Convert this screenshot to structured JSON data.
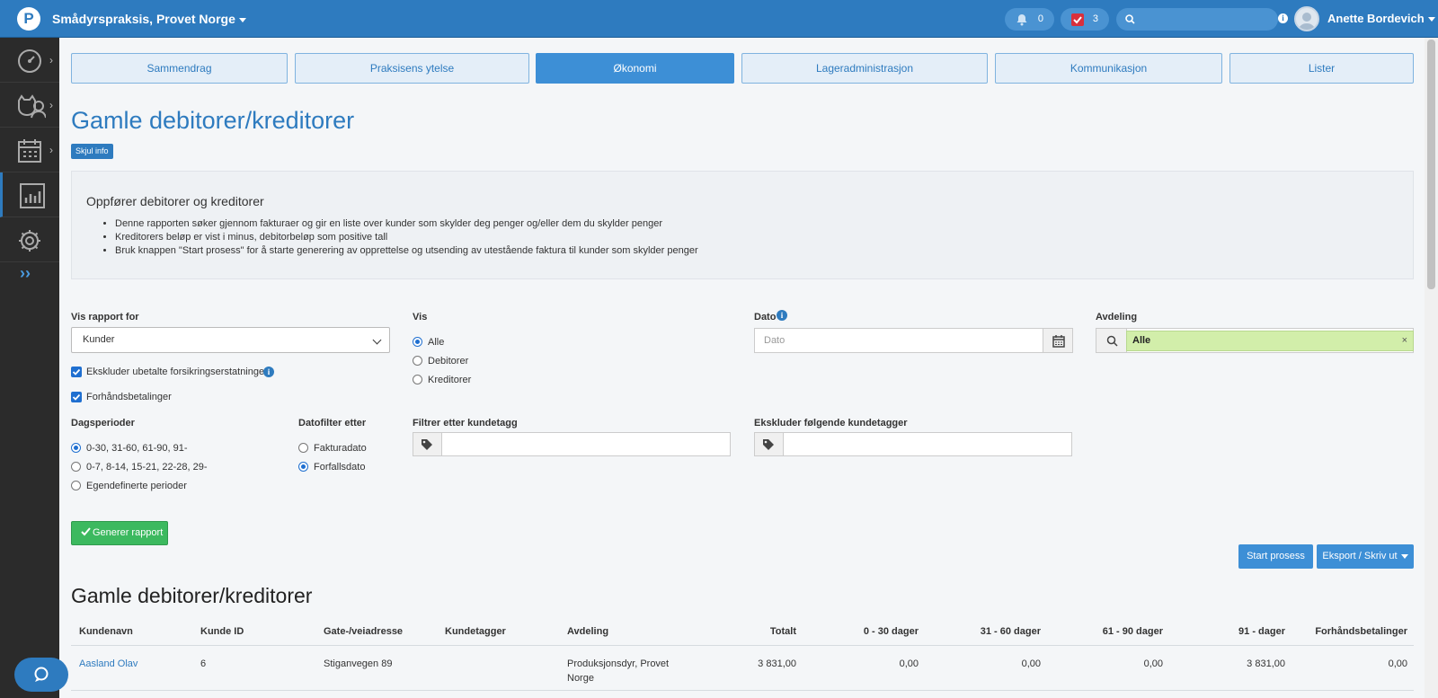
{
  "header": {
    "clinic": "Smådyrspraksis, Provet Norge",
    "notifications_count": "0",
    "tasks_count": "3",
    "user_name": "Anette Bordevich"
  },
  "tabs": [
    "Sammendrag",
    "Praksisens ytelse",
    "Økonomi",
    "Lageradministrasjon",
    "Kommunikasjon",
    "Lister"
  ],
  "page": {
    "title": "Gamle debitorer/kreditorer",
    "toggle_info": "Skjul info"
  },
  "info": {
    "heading": "Oppfører debitorer og kreditorer",
    "bullets": [
      "Denne rapporten søker gjennom fakturaer og gir en liste over kunder som skylder deg penger og/eller dem du skylder penger",
      "Kreditorers beløp er vist i minus, debitorbeløp som positive tall",
      "Bruk knappen \"Start prosess\" for å starte generering av opprettelse og utsending av utestående faktura til kunder som skylder penger"
    ]
  },
  "filters": {
    "report_for_label": "Vis rapport for",
    "report_for_value": "Kunder",
    "exclude_insurance": "Ekskluder ubetalte forsikringserstatninger",
    "prepayments": "Forhåndsbetalinger",
    "show_label": "Vis",
    "show_options": [
      "Alle",
      "Debitorer",
      "Kreditorer"
    ],
    "date_label": "Dato",
    "date_placeholder": "Dato",
    "department_label": "Avdeling",
    "department_value": "Alle",
    "day_periods_label": "Dagsperioder",
    "day_periods": [
      "0-30, 31-60, 61-90, 91-",
      "0-7, 8-14, 15-21, 22-28, 29-",
      "Egendefinerte perioder"
    ],
    "date_filter_label": "Datofilter etter",
    "date_filter_options": [
      "Fakturadato",
      "Forfallsdato"
    ],
    "filter_tags_label": "Filtrer etter kundetagg",
    "exclude_tags_label": "Ekskluder følgende kundetagger"
  },
  "buttons": {
    "generate": "Generer rapport",
    "start_process": "Start prosess",
    "export": "Eksport / Skriv ut"
  },
  "table": {
    "title": "Gamle debitorer/kreditorer",
    "columns": [
      "Kundenavn",
      "Kunde ID",
      "Gate-/veiadresse",
      "Kundetagger",
      "Avdeling",
      "Totalt",
      "0 - 30 dager",
      "31 - 60 dager",
      "61 - 90 dager",
      "91 - dager",
      "Forhåndsbetalinger"
    ],
    "rows": [
      {
        "name": "Aasland Olav",
        "id": "6",
        "address": "Stiganvegen 89",
        "tags": "",
        "department_line1": "Produksjonsdyr, Provet",
        "department_line2": "Norge",
        "total": "3 831,00",
        "d0_30": "0,00",
        "d31_60": "0,00",
        "d61_90": "0,00",
        "d91": "3 831,00",
        "prepayments": "0,00"
      }
    ]
  }
}
